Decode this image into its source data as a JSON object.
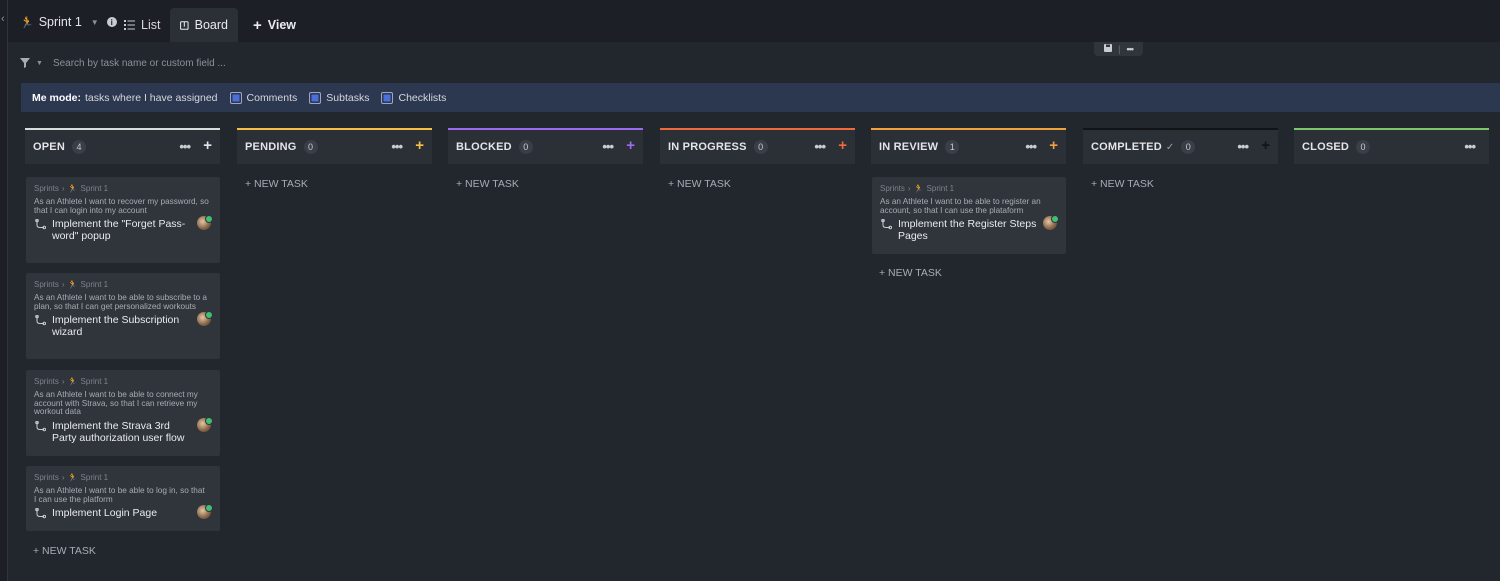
{
  "topbar": {
    "sprint_label": "Sprint 1",
    "tabs": [
      {
        "label": "List",
        "icon": "list-icon"
      },
      {
        "label": "Board",
        "icon": "board-icon"
      },
      {
        "label": "View",
        "icon": "plus-icon"
      }
    ]
  },
  "filter": {
    "placeholder": "Search by task name or custom field ..."
  },
  "me_mode": {
    "title": "Me mode:",
    "description": "tasks where I have assigned",
    "options": [
      "Comments",
      "Subtasks",
      "Checklists"
    ]
  },
  "columns": [
    {
      "name": "OPEN",
      "count": "4",
      "color": "#d9dadc",
      "plus_color": "#e3e5e8"
    },
    {
      "name": "PENDING",
      "count": "0",
      "color": "#f5c043",
      "plus_color": "#f5c043"
    },
    {
      "name": "BLOCKED",
      "count": "0",
      "color": "#9b6bf2",
      "plus_color": "#9b6bf2"
    },
    {
      "name": "IN PROGRESS",
      "count": "0",
      "color": "#f06a3c",
      "plus_color": "#f06a3c"
    },
    {
      "name": "IN REVIEW",
      "count": "1",
      "color": "#f0a13b",
      "plus_color": "#f0a13b"
    },
    {
      "name": "COMPLETED",
      "count": "0",
      "color": "#111317",
      "plus_color": "#111317"
    },
    {
      "name": "CLOSED",
      "count": "0",
      "color": "#7cc66b",
      "plus_color": ""
    }
  ],
  "new_task_label": "+ NEW TASK",
  "breadcrumb": {
    "root": "Sprints",
    "sprint": "Sprint 1"
  },
  "cards": [
    {
      "column": "OPEN",
      "story": "As an Athlete I want to recover my password, so that I can login into my account",
      "title": "Implement the \"Forget Pass-word\" popup"
    },
    {
      "column": "OPEN",
      "story": "As an Athlete I want to be able to subscribe to a plan, so that I can get personalized workouts",
      "title": "Implement the Subscription wizard"
    },
    {
      "column": "OPEN",
      "story": "As an Athlete I want to be able to connect my account with Strava, so that I can retrieve my workout data",
      "title": "Implement the Strava 3rd Party authorization user flow"
    },
    {
      "column": "OPEN",
      "story": "As an Athlete I want to be able to log in, so that I can use the platform",
      "title": "Implement Login Page"
    },
    {
      "column": "IN REVIEW",
      "story": "As an Athlete I want to be able to register an account, so that I can use the plataform",
      "title": "Implement the Register Steps Pages"
    }
  ]
}
